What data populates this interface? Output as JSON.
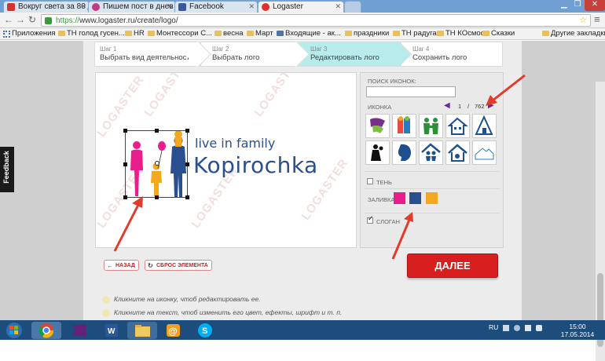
{
  "browser": {
    "tabs": [
      {
        "title": "Вокруг света за 80 д",
        "color": "#d4332c"
      },
      {
        "title": "Пишем пост в днев",
        "color": "#c03a87"
      },
      {
        "title": "Facebook",
        "color": "#3b5998"
      },
      {
        "title": "Logaster",
        "color": "#e0302b"
      }
    ],
    "url_scheme": "https://",
    "url_rest": "www.logaster.ru/create/logo/",
    "bookmarks": [
      "Приложения",
      "ТН голод гусен...",
      "HR",
      "Монтессори С...",
      "весна",
      "Март",
      "Входящие - ак...",
      "праздники",
      "ТН радуга",
      "ТН КОсмос",
      "Сказки",
      "Другие закладки"
    ]
  },
  "steps": [
    {
      "num": "Шаг 1",
      "label": "Выбрать вид деятельности"
    },
    {
      "num": "Шаг 2",
      "label": "Выбрать лого"
    },
    {
      "num": "Шаг 3",
      "label": "Редактировать лого"
    },
    {
      "num": "Шаг 4",
      "label": "Сохранить лого"
    }
  ],
  "logo": {
    "slogan": "live in family",
    "name": "Kopirochka",
    "watermark": "LOGASTER"
  },
  "panel": {
    "search_label": "ПОИСК ИКОНОК:",
    "icon_label": "ИКОНКА",
    "page_current": "1",
    "page_sep": "/",
    "page_total": "762",
    "shadow_label": "ТЕНЬ",
    "fill_label": "ЗАЛИВКА",
    "slogan_label": "СЛОГАН",
    "fill_colors": [
      "#e91e8c",
      "#2a4f8f",
      "#f4a81c"
    ]
  },
  "buttons": {
    "back": "НАЗАД",
    "reset": "СБРОС ЭЛЕМЕНТА",
    "next": "ДАЛЕЕ"
  },
  "hints": [
    "Кликните на иконку, чтоб редактировать ее.",
    "Кликните на текст, чтоб изменить его цвет, ефекты, шрифт и т. п."
  ],
  "feedback": "Feedback",
  "system": {
    "lang": "RU",
    "time": "15:00",
    "date": "17.05.2014"
  }
}
